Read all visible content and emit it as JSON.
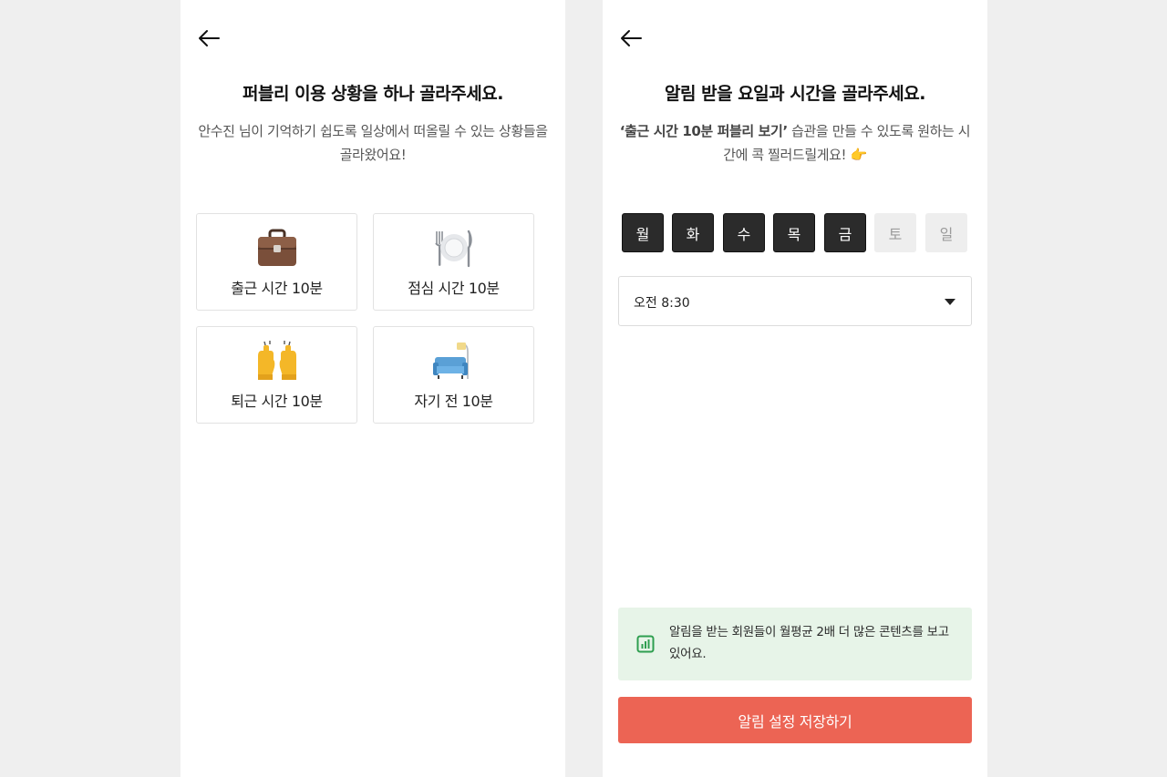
{
  "left_screen": {
    "title": "퍼블리 이용 상황을 하나 골라주세요.",
    "subtitle": "안수진 님이 기억하기 쉽도록 일상에서 떠올릴 수 있는 상황들을 골라왔어요!",
    "options": [
      {
        "label": "출근 시간 10분",
        "icon": "briefcase-icon"
      },
      {
        "label": "점심 시간 10분",
        "icon": "plate-cutlery-icon"
      },
      {
        "label": "퇴근 시간 10분",
        "icon": "raising-hands-icon"
      },
      {
        "label": "자기 전 10분",
        "icon": "couch-lamp-icon"
      }
    ]
  },
  "right_screen": {
    "title": "알림 받을 요일과 시간을 골라주세요.",
    "subtitle_bold": "‘출근 시간 10분 퍼블리 보기’",
    "subtitle_rest": " 습관을 만들 수 있도록 원하는 시간에 콕 찔러드릴게요! 👉",
    "days": [
      {
        "label": "월",
        "selected": true
      },
      {
        "label": "화",
        "selected": true
      },
      {
        "label": "수",
        "selected": true
      },
      {
        "label": "목",
        "selected": true
      },
      {
        "label": "금",
        "selected": true
      },
      {
        "label": "토",
        "selected": false
      },
      {
        "label": "일",
        "selected": false
      }
    ],
    "time_select": {
      "value": "오전 8:30"
    },
    "info": {
      "text": "알림을 받는 회원들이 월평균 2배 더 많은 콘텐츠를 보고 있어요.",
      "icon": "bar-chart-icon"
    },
    "save_button": "알림 설정 저장하기"
  },
  "colors": {
    "accent": "#ec6454",
    "day_selected": "#2b2b2b",
    "day_unselected": "#eeeeee",
    "info_bg": "#e7f4e8",
    "info_icon": "#2e9e4f"
  }
}
